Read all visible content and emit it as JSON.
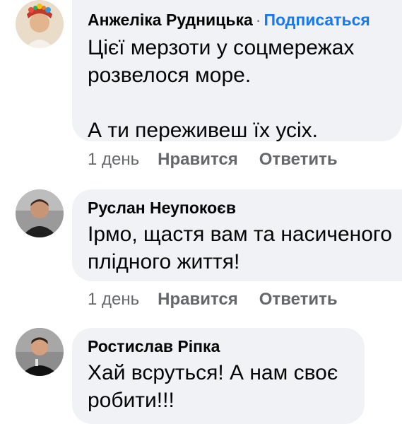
{
  "comments": [
    {
      "author": "Анжеліка Рудницька",
      "separator": "·",
      "follow_label": "Подписаться",
      "text": "Цієї мерзоти у соцмережах\nрозвелося море.\n\nА ти переживеш їх усіх.",
      "time": "1 день",
      "like_label": "Нравится",
      "reply_label": "Ответить"
    },
    {
      "author": "Руслан Неупокоєв",
      "text": "Ірмо, щастя вам та насиченого\nплідного життя!",
      "time": "1 день",
      "like_label": "Нравится",
      "reply_label": "Ответить"
    },
    {
      "author": "Ростислав Ріпка",
      "text": "Хай всруться! А нам своє\nробити!!!"
    }
  ],
  "colors": {
    "bubble_bg": "#f0f2f5",
    "link_blue": "#1877f2",
    "meta_gray": "#65676b"
  }
}
